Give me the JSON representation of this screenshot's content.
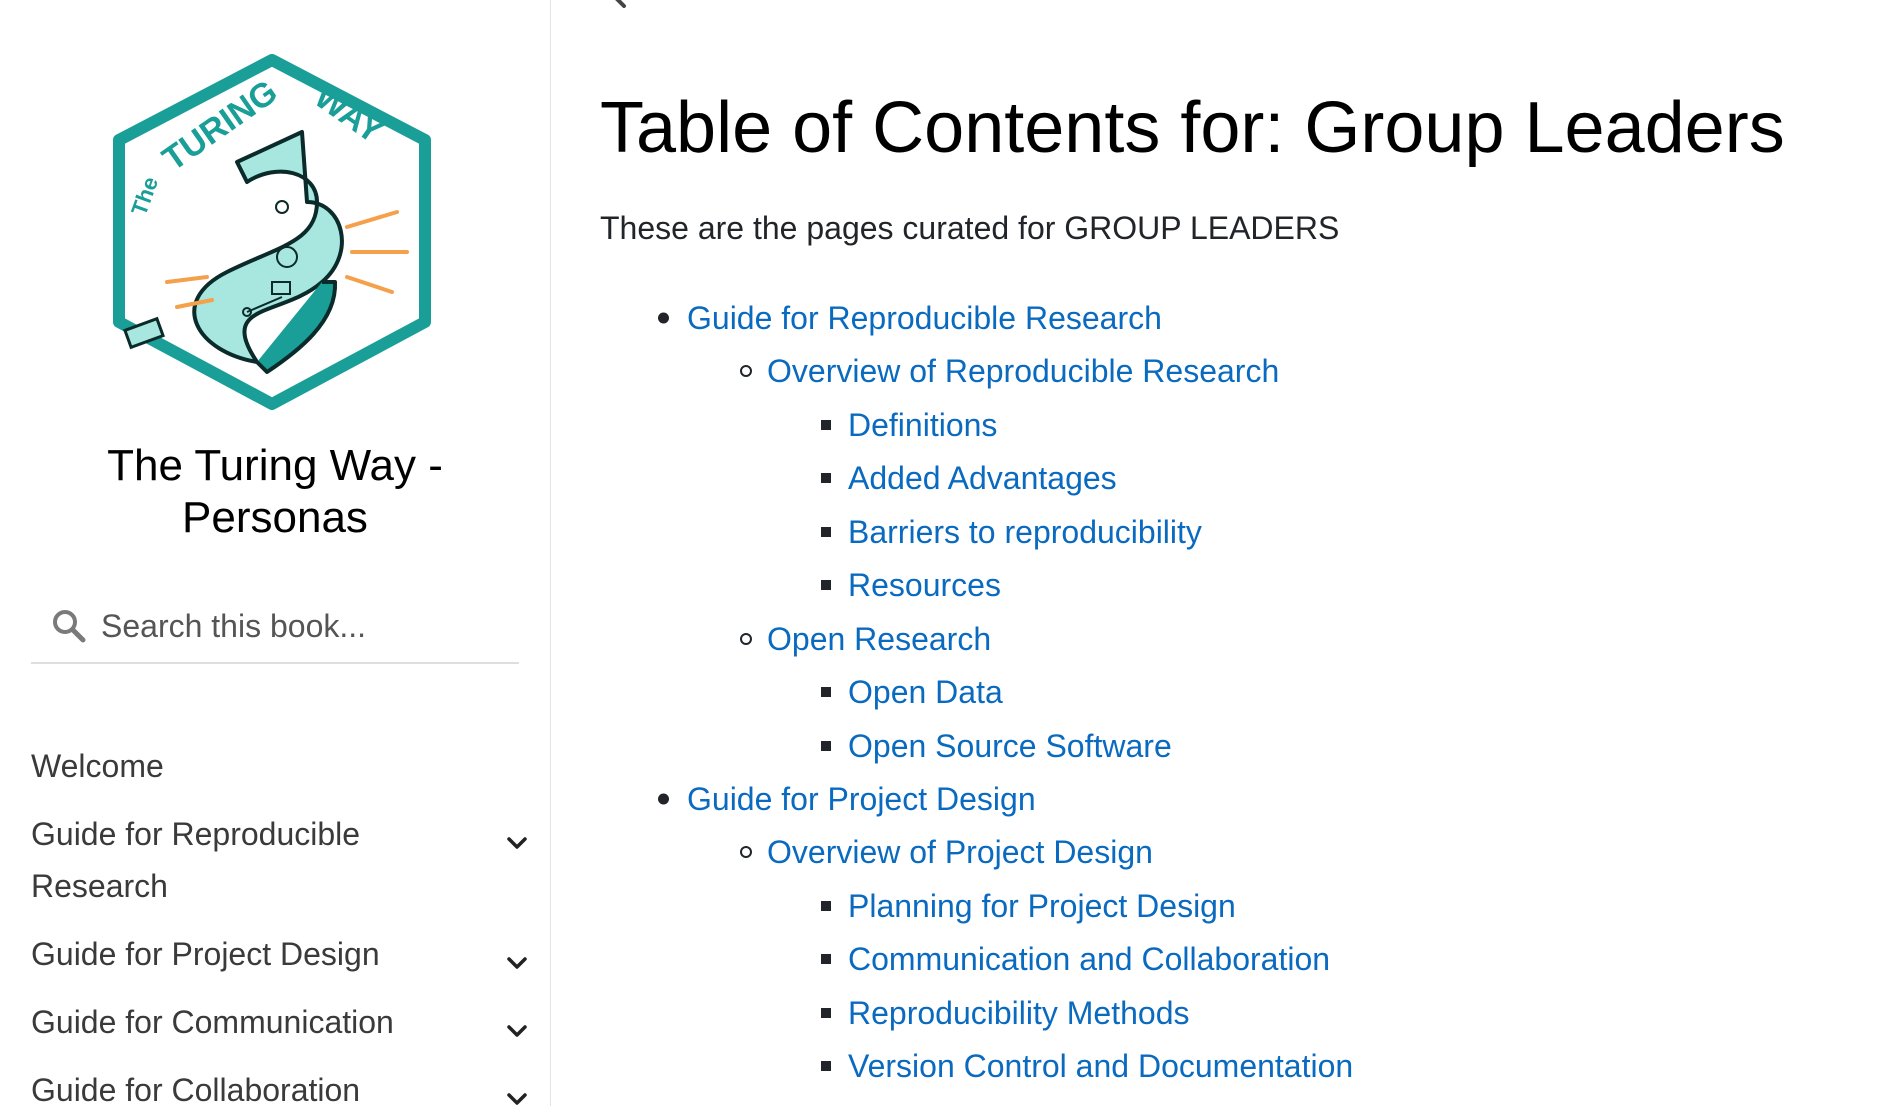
{
  "sidebar": {
    "book_title": "The Turing Way - Personas",
    "logo_text": "The TURING WAY",
    "search": {
      "placeholder": "Search this book..."
    },
    "nav": [
      {
        "label": "Welcome",
        "expandable": false
      },
      {
        "label": "Guide for Reproducible Research",
        "expandable": true
      },
      {
        "label": "Guide for Project Design",
        "expandable": true
      },
      {
        "label": "Guide for Communication",
        "expandable": true
      },
      {
        "label": "Guide for Collaboration",
        "expandable": true
      }
    ]
  },
  "main": {
    "title": "Table of Contents for: Group Leaders",
    "intro": "These are the pages curated for GROUP LEADERS",
    "toc": [
      {
        "level": 1,
        "label": "Guide for Reproducible Research"
      },
      {
        "level": 2,
        "label": "Overview of Reproducible Research"
      },
      {
        "level": 3,
        "label": "Definitions"
      },
      {
        "level": 3,
        "label": "Added Advantages"
      },
      {
        "level": 3,
        "label": "Barriers to reproducibility"
      },
      {
        "level": 3,
        "label": "Resources"
      },
      {
        "level": 2,
        "label": "Open Research"
      },
      {
        "level": 3,
        "label": "Open Data"
      },
      {
        "level": 3,
        "label": "Open Source Software"
      },
      {
        "level": 1,
        "label": "Guide for Project Design"
      },
      {
        "level": 2,
        "label": "Overview of Project Design"
      },
      {
        "level": 3,
        "label": "Planning for Project Design"
      },
      {
        "level": 3,
        "label": "Communication and Collaboration"
      },
      {
        "level": 3,
        "label": "Reproducibility Methods"
      },
      {
        "level": 3,
        "label": "Version Control and Documentation"
      }
    ]
  },
  "colors": {
    "link": "#0a6abf",
    "logo_teal": "#1a9e98",
    "logo_light": "#a8e6e0",
    "logo_orange": "#f5a04a"
  }
}
